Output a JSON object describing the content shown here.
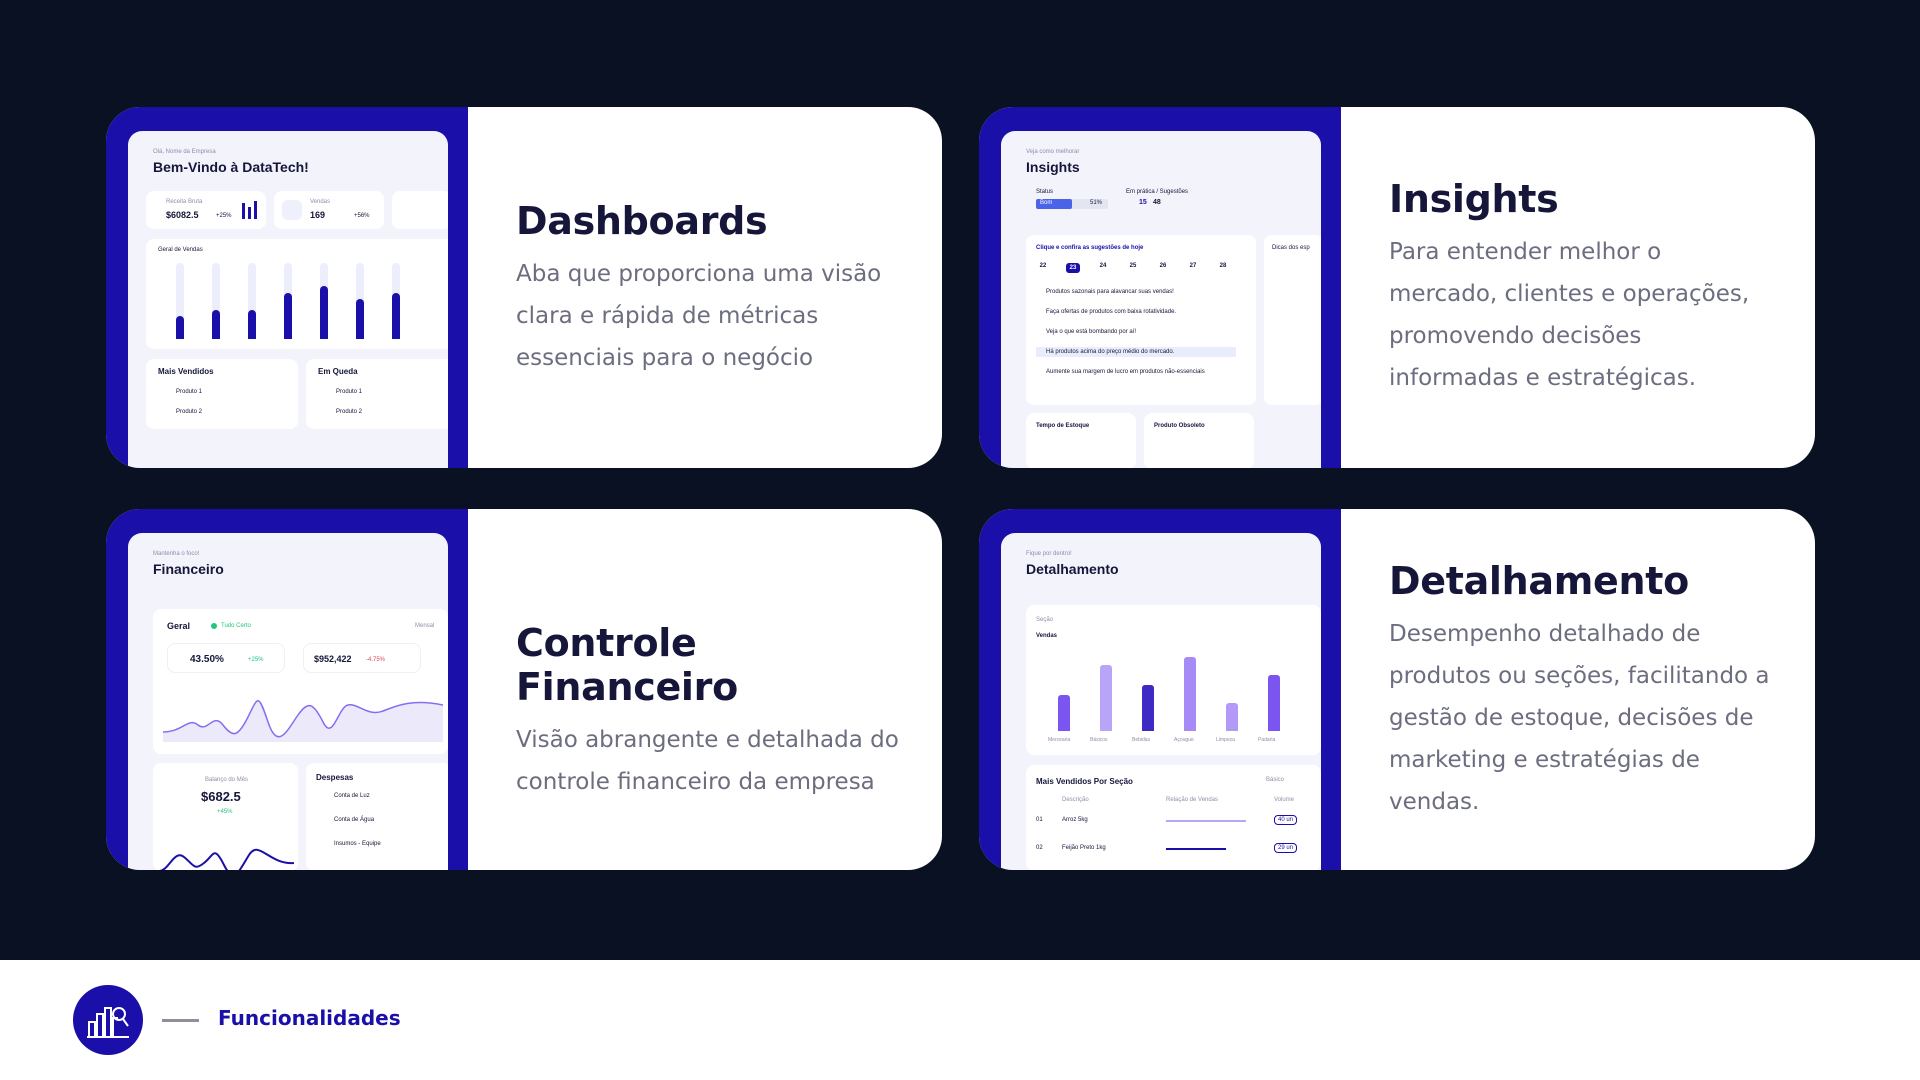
{
  "cards": [
    {
      "title": "Dashboards",
      "description": "Aba que proporciona uma visão clara e rápida de métricas essenciais para o negócio",
      "screenshot": {
        "greeting": "Olá, Nome da Empresa",
        "heading": "Bem-Vindo à DataTech!",
        "stat1_label": "Receita Bruta",
        "stat1_value": "$6082.5",
        "stat1_change": "+25%",
        "stat2_label": "Vendas",
        "stat2_value": "169",
        "stat2_change": "+56%",
        "chart_title": "Geral de Vendas",
        "list1_title": "Mais Vendidos",
        "list2_title": "Em Queda",
        "item1": "Produto 1",
        "item2": "Produto 2"
      }
    },
    {
      "title": "Insights",
      "description": "Para entender melhor o mercado, clientes e operações, promovendo decisões informadas e estratégicas.",
      "screenshot": {
        "subtitle": "Veja como melhorar",
        "heading": "Insights",
        "status_label": "Status",
        "status_value": "Bom",
        "status_pct": "51%",
        "practice_label": "Em prática / Sugestões",
        "practice_a": "15",
        "practice_b": "48",
        "suggestions_title": "Clique e confira as sugestões de hoje",
        "days": [
          "22",
          "23",
          "24",
          "25",
          "26",
          "27",
          "28"
        ],
        "tips": [
          "Produtos sazonais para alavancar suas vendas!",
          "Faça ofertas de produtos com baixa rotatividade.",
          "Veja o que está bombando por aí!",
          "Há produtos acima do preço médio do mercado.",
          "Aumente sua margem de lucro em produtos não-essenciais"
        ],
        "side_title": "Dicas dos esp",
        "stock_title": "Tempo de Estoque",
        "obsolete_title": "Produto Obsoleto"
      }
    },
    {
      "title": "Controle Financeiro",
      "description": "Visão abrangente e detalhada do controle financeiro da empresa",
      "screenshot": {
        "subtitle": "Mantenha o foco!",
        "heading": "Financeiro",
        "general": "Geral",
        "all_good": "Tudo Certo",
        "period": "Mensal",
        "margin_value": "43.50%",
        "margin_change": "+25%",
        "balance_value": "$952,422",
        "balance_change": "-4.75%",
        "month_label": "Balanço do Mês",
        "month_value": "$682.5",
        "month_change": "+45%",
        "expenses_title": "Despesas",
        "expenses": [
          "Conta de Luz",
          "Conta de Água",
          "Insumos - Equipe"
        ]
      }
    },
    {
      "title": "Detalhamento",
      "description": "Desempenho detalhado de produtos ou seções, facilitando a gestão de estoque, decisões de marketing e estratégias de vendas.",
      "screenshot": {
        "subtitle": "Fique por dentro!",
        "heading": "Detalhamento",
        "section_label": "Seção",
        "chart_title": "Vendas",
        "categories": [
          "Mercearia",
          "Básicos",
          "Bebidas",
          "Açougue",
          "Limpeza",
          "Padaria"
        ],
        "values": [
          0.45,
          0.82,
          0.58,
          0.92,
          0.35,
          0.7
        ],
        "bar_colors": [
          "#7a55f0",
          "#b9a5f7",
          "#3d29c4",
          "#a68af5",
          "#b39af7",
          "#7a55f0"
        ],
        "table_title": "Mais Vendidos Por Seção",
        "table_filter": "Básico",
        "col_desc": "Descrição",
        "col_rel": "Relação de Vendas",
        "col_vol": "Volume",
        "rows": [
          {
            "id": "01",
            "name": "Arroz 5kg",
            "volume": "40 un"
          },
          {
            "id": "02",
            "name": "Feijão Preto 1kg",
            "volume": "29 un"
          }
        ]
      }
    }
  ],
  "footer": {
    "label": "Funcionalidades",
    "logo_icon": "city-chart-icon"
  },
  "colors": {
    "background_dark": "#0a1123",
    "accent_blue": "#1a0fa8",
    "card_white": "#ffffff",
    "title_text": "#15163a",
    "body_text": "#6c6e80"
  }
}
